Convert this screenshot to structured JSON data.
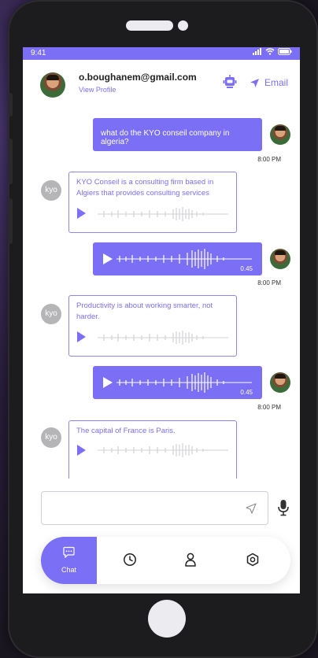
{
  "status_bar": {
    "time": "9:41"
  },
  "header": {
    "email": "o.boughanem@gmail.com",
    "view_profile": "View Profile",
    "email_button": "Email"
  },
  "messages": {
    "m1": {
      "text": "what do the KYO conseil company in algeria?",
      "time": "8:00 PM"
    },
    "m2": {
      "avatar": "kyo",
      "text": "KYO Conseil is a consulting firm based in Algiers that provides consulting services"
    },
    "m3": {
      "duration": "0.45",
      "time": "8:00 PM"
    },
    "m4": {
      "avatar": "kyo",
      "text": "Productivity is about working smarter, not harder."
    },
    "m5": {
      "duration": "0.45",
      "time": "8:00 PM"
    },
    "m6": {
      "avatar": "kyo",
      "text": "The capital of France is Paris."
    }
  },
  "input": {
    "placeholder": ""
  },
  "tabs": {
    "chat": "Chat",
    "history_icon": "clock-icon",
    "profile_icon": "person-icon",
    "settings_icon": "settings-icon"
  },
  "colors": {
    "accent": "#7b6ff5",
    "background": "#ffffff",
    "frame": "#1c1c1e"
  }
}
